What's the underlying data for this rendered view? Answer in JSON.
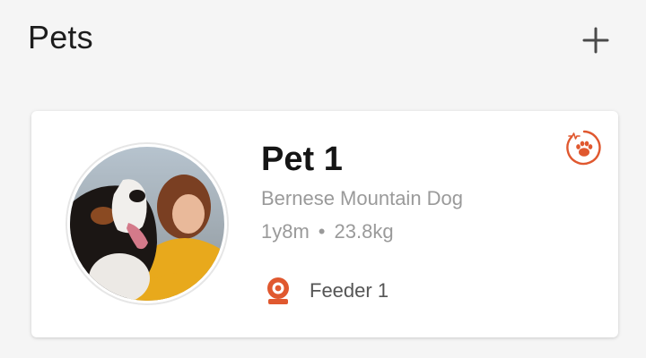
{
  "header": {
    "title": "Pets",
    "add_icon": "plus-icon"
  },
  "colors": {
    "accent": "#e0582f",
    "text_primary": "#1a1a1a",
    "text_secondary": "#9a9a9a",
    "card_bg": "#ffffff",
    "page_bg": "#f5f5f5"
  },
  "pets": [
    {
      "name": "Pet 1",
      "breed": "Bernese Mountain Dog",
      "age": "1y8m",
      "separator": "•",
      "weight": "23.8kg",
      "photo_icon": "pet-photo",
      "status_icon": "paw-health-icon",
      "device": {
        "icon": "camera-feeder-icon",
        "label": "Feeder 1"
      }
    }
  ]
}
